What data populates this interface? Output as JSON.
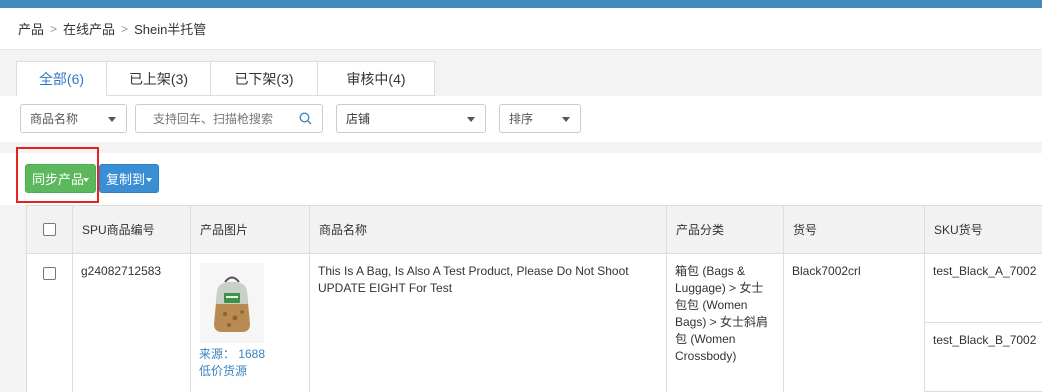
{
  "breadcrumb": {
    "items": [
      "产品",
      "在线产品",
      "Shein半托管"
    ],
    "separator": ">"
  },
  "tabs": [
    {
      "label": "全部(6)",
      "active": true
    },
    {
      "label": "已上架(3)",
      "active": false
    },
    {
      "label": "已下架(3)",
      "active": false
    },
    {
      "label": "审核中(4)",
      "active": false
    }
  ],
  "filters": {
    "field_select": "商品名称",
    "search_placeholder": "支持回车、扫描枪搜索",
    "shop_select": "店铺",
    "sort_select": "排序"
  },
  "toolbar": {
    "sync_label": "同步产品",
    "copy_label": "复制到"
  },
  "table": {
    "headers": [
      "SPU商品编号",
      "产品图片",
      "商品名称",
      "产品分类",
      "货号",
      "SKU货号"
    ],
    "rows": [
      {
        "spu": "g24082712583",
        "image_source_line1": "来源： 1688",
        "image_source_line2": "低价货源",
        "name": "This Is A Bag, Is Also A Test Product, Please Do Not Shoot UPDATE EIGHT For Test",
        "category": "箱包 (Bags & Luggage) > 女士包包 (Women Bags) > 女士斜肩包 (Women Crossbody)",
        "item_no": "Black7002crl",
        "skus": [
          "test_Black_A_7002",
          "test_Black_B_7002"
        ]
      }
    ]
  },
  "colors": {
    "accent": "#3279c6",
    "sync_button": "#5cb85c",
    "copy_button": "#3a8fd4",
    "highlight": "#e8231e",
    "topbar": "#3f8bbd"
  }
}
